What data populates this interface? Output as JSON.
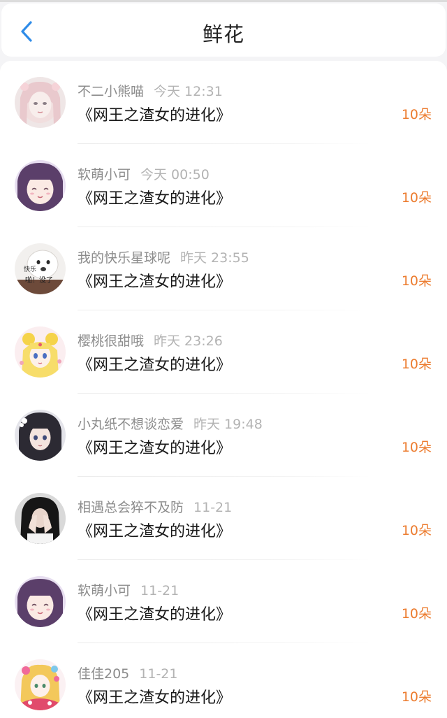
{
  "header": {
    "title": "鲜花",
    "back_icon": "chevron-left-icon",
    "accent_color": "#2f8ce8"
  },
  "count_color": "#ec7c2f",
  "items": [
    {
      "user": "不二小熊喵",
      "time": "今天 12:31",
      "book": "《网王之渣女的进化》",
      "count": "10朵",
      "avatar": "avatar-girl-pink-hair"
    },
    {
      "user": "软萌小可",
      "time": "今天 00:50",
      "book": "《网王之渣女的进化》",
      "count": "10朵",
      "avatar": "avatar-anime-purple-hair"
    },
    {
      "user": "我的快乐星球呢",
      "time": "昨天 23:55",
      "book": "《网王之渣女的进化》",
      "count": "10朵",
      "avatar": "avatar-dog-meme",
      "avatar_text": [
        "快乐",
        "啪！没了"
      ]
    },
    {
      "user": "樱桃很甜哦",
      "time": "昨天 23:26",
      "book": "《网王之渣女的进化》",
      "count": "10朵",
      "avatar": "avatar-sailor-moon"
    },
    {
      "user": "小丸纸不想谈恋爱",
      "time": "昨天 19:48",
      "book": "《网王之渣女的进化》",
      "count": "10朵",
      "avatar": "avatar-anime-dark-hair"
    },
    {
      "user": "相遇总会猝不及防",
      "time": "11-21",
      "book": "《网王之渣女的进化》",
      "count": "10朵",
      "avatar": "avatar-girl-covering-face"
    },
    {
      "user": "软萌小可",
      "time": "11-21",
      "book": "《网王之渣女的进化》",
      "count": "10朵",
      "avatar": "avatar-anime-purple-hair"
    },
    {
      "user": "佳佳205",
      "time": "11-21",
      "book": "《网王之渣女的进化》",
      "count": "10朵",
      "avatar": "avatar-anime-colorful"
    }
  ]
}
